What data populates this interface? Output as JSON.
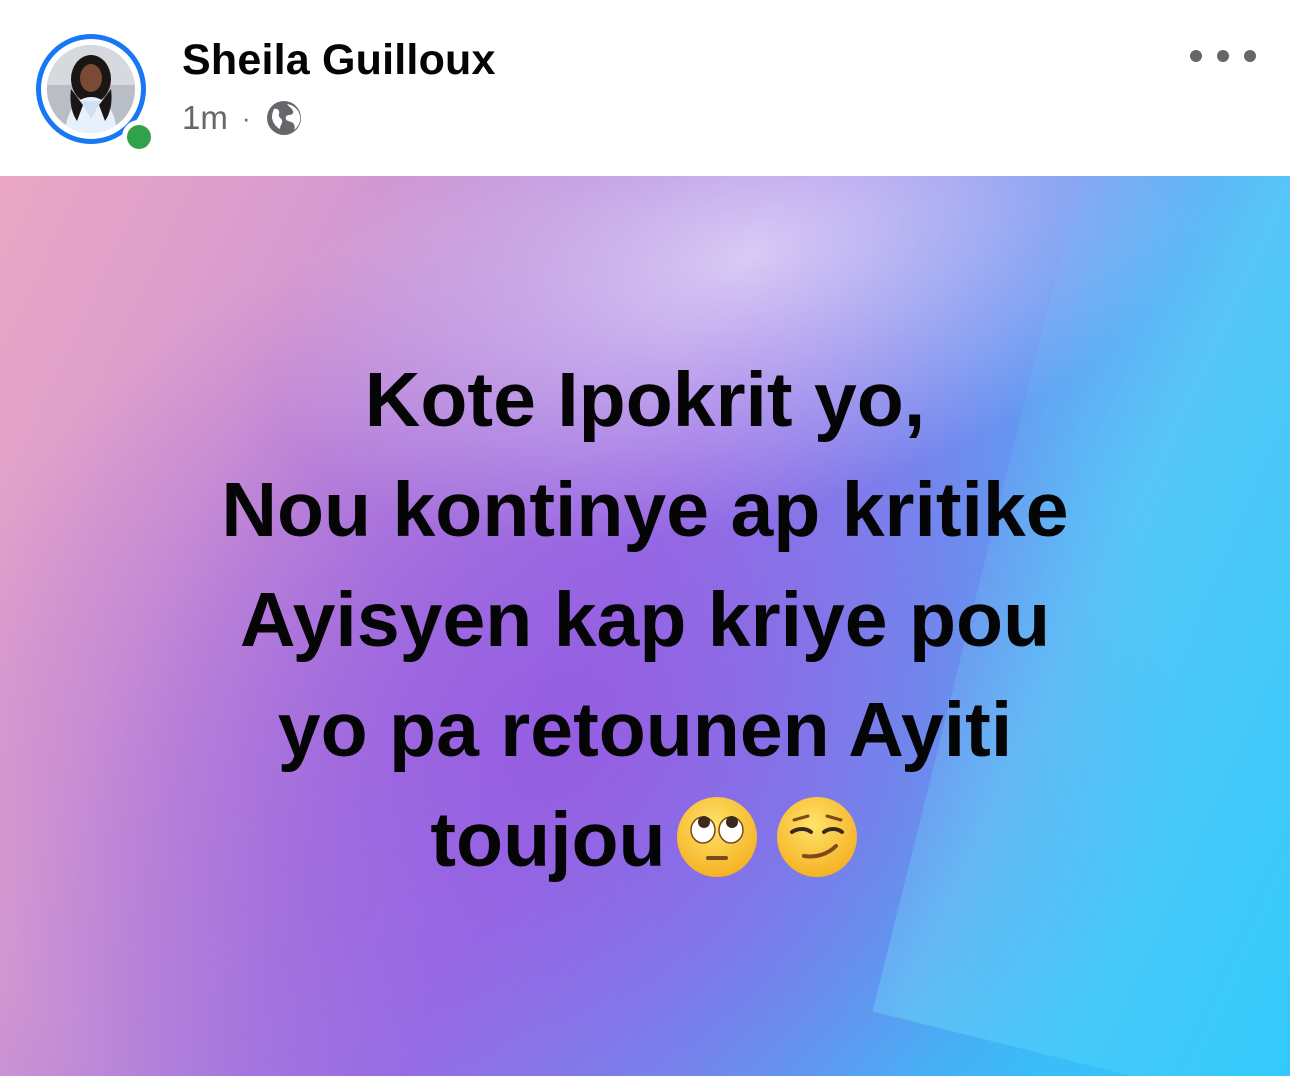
{
  "author": {
    "name": "Sheila Guilloux",
    "online": true
  },
  "meta": {
    "time": "1m",
    "separator": "·",
    "audience_icon": "globe-icon"
  },
  "more_button_icon": "more-horizontal-icon",
  "post": {
    "lines": [
      "Kote Ipokrit yo,",
      "Nou kontinye ap kritike",
      "Ayisyen kap kriye pou",
      "yo pa retounen Ayiti",
      "toujou"
    ],
    "emojis": [
      "eye-roll-emoji",
      "smirk-emoji"
    ],
    "background": "pink-purple-cyan-gradient"
  },
  "colors": {
    "ring": "#1877f2",
    "online": "#31a24c",
    "meta_text": "#65676b",
    "text": "#050505"
  }
}
